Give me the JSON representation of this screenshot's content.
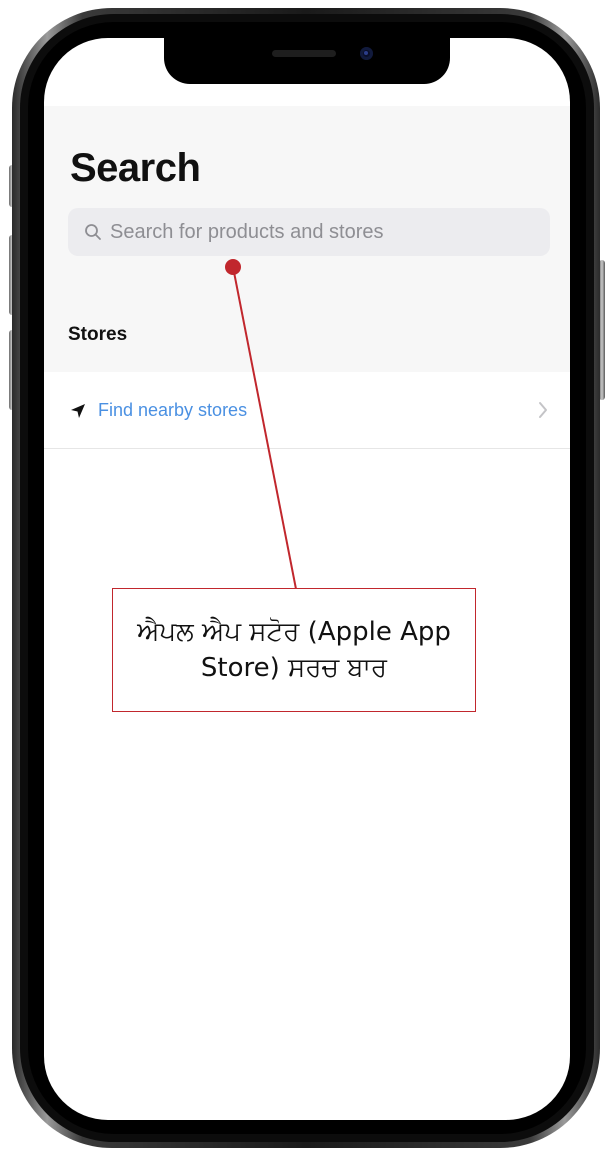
{
  "app": {
    "title": "Search",
    "search": {
      "placeholder": "Search for products and stores",
      "value": ""
    },
    "stores_section": {
      "title": "Stores"
    },
    "find_nearby": {
      "label": "Find nearby stores"
    }
  },
  "annotation": {
    "text": "ਐਪਲ ਐਪ ਸਟੋਰ (Apple App Store) ਸਰਚ ਬਾਰ"
  },
  "icons": {
    "search": "search-icon",
    "location": "location-arrow-icon",
    "chevron": "chevron-right-icon"
  },
  "colors": {
    "link": "#4a90e2",
    "annotation": "#c1272d",
    "search_bar_bg": "#ececef",
    "nav_bg": "#f7f7f7"
  }
}
